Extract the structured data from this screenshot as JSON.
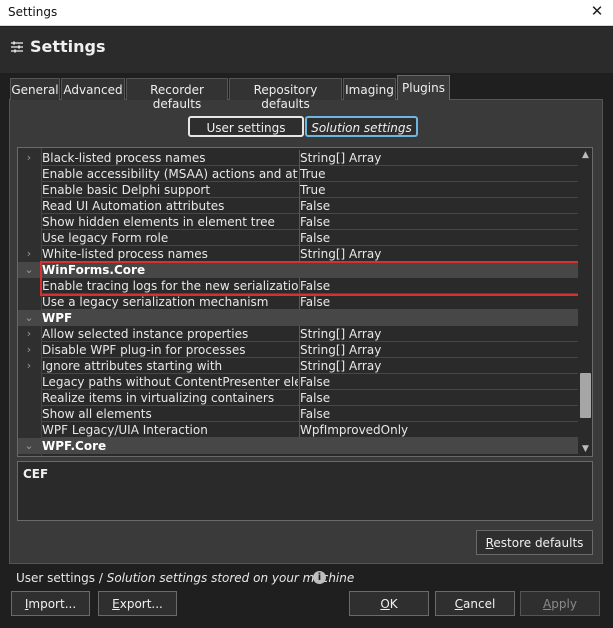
{
  "window": {
    "title": "Settings",
    "close_glyph": "✕"
  },
  "header": {
    "title": "Settings",
    "icon": "settings-sliders-icon"
  },
  "tabs": [
    {
      "label": "General"
    },
    {
      "label": "Advanced"
    },
    {
      "label": "Recorder defaults"
    },
    {
      "label": "Repository defaults"
    },
    {
      "label": "Imaging"
    },
    {
      "label": "Plugins",
      "active": true
    }
  ],
  "mode": {
    "user_label": "User settings",
    "solution_label": "Solution settings"
  },
  "grid": {
    "rows": [
      {
        "name": "Black-listed process names",
        "value": "String[] Array",
        "expander": "›"
      },
      {
        "name": "Enable accessibility (MSAA) actions and attribut",
        "value": "True",
        "expander": ""
      },
      {
        "name": "Enable basic Delphi support",
        "value": "True",
        "expander": ""
      },
      {
        "name": "Read UI Automation attributes",
        "value": "False",
        "expander": ""
      },
      {
        "name": "Show hidden elements in element tree",
        "value": "False",
        "expander": ""
      },
      {
        "name": "Use legacy Form role",
        "value": "False",
        "expander": ""
      },
      {
        "name": "White-listed process names",
        "value": "String[] Array",
        "expander": "›"
      },
      {
        "name": "WinForms.Core",
        "value": "",
        "expander": "⌄",
        "category": true
      },
      {
        "name": "Enable tracing logs for the new serialization",
        "value": "False",
        "expander": ""
      },
      {
        "name": "Use a legacy serialization mechanism",
        "value": "False",
        "expander": ""
      },
      {
        "name": "WPF",
        "value": "",
        "expander": "⌄",
        "category": true
      },
      {
        "name": "Allow selected instance properties",
        "value": "String[] Array",
        "expander": "›"
      },
      {
        "name": "Disable WPF plug-in for processes",
        "value": "String[] Array",
        "expander": "›"
      },
      {
        "name": "Ignore attributes starting with",
        "value": "String[] Array",
        "expander": "›"
      },
      {
        "name": "Legacy paths without ContentPresenter element",
        "value": "False",
        "expander": ""
      },
      {
        "name": "Realize items in virtualizing containers",
        "value": "False",
        "expander": ""
      },
      {
        "name": "Show all elements",
        "value": "False",
        "expander": ""
      },
      {
        "name": "WPF Legacy/UIA Interaction",
        "value": "WpfImprovedOnly",
        "expander": ""
      },
      {
        "name": "WPF.Core",
        "value": "",
        "expander": "⌄",
        "category": true
      }
    ],
    "scroll_up_glyph": "▲",
    "scroll_down_glyph": "▼"
  },
  "description": {
    "title": "CEF"
  },
  "buttons": {
    "restore_defaults": {
      "prefix": "",
      "underlined": "R",
      "rest": "estore defaults"
    },
    "import": {
      "prefix": "",
      "underlined": "I",
      "rest": "mport..."
    },
    "export": {
      "prefix": "",
      "underlined": "E",
      "rest": "xport..."
    },
    "ok": {
      "prefix": "",
      "underlined": "O",
      "rest": "K"
    },
    "cancel": {
      "prefix": "",
      "underlined": "C",
      "rest": "ancel"
    },
    "apply": {
      "prefix": "",
      "underlined": "A",
      "rest": "pply"
    }
  },
  "footer": {
    "part1": "User settings / ",
    "part2": "Solution settings stored ",
    "part3": " on your machine",
    "info_glyph": "i"
  },
  "colors": {
    "highlight_border": "#d8302f",
    "solution_border": "#6cb6e0"
  }
}
